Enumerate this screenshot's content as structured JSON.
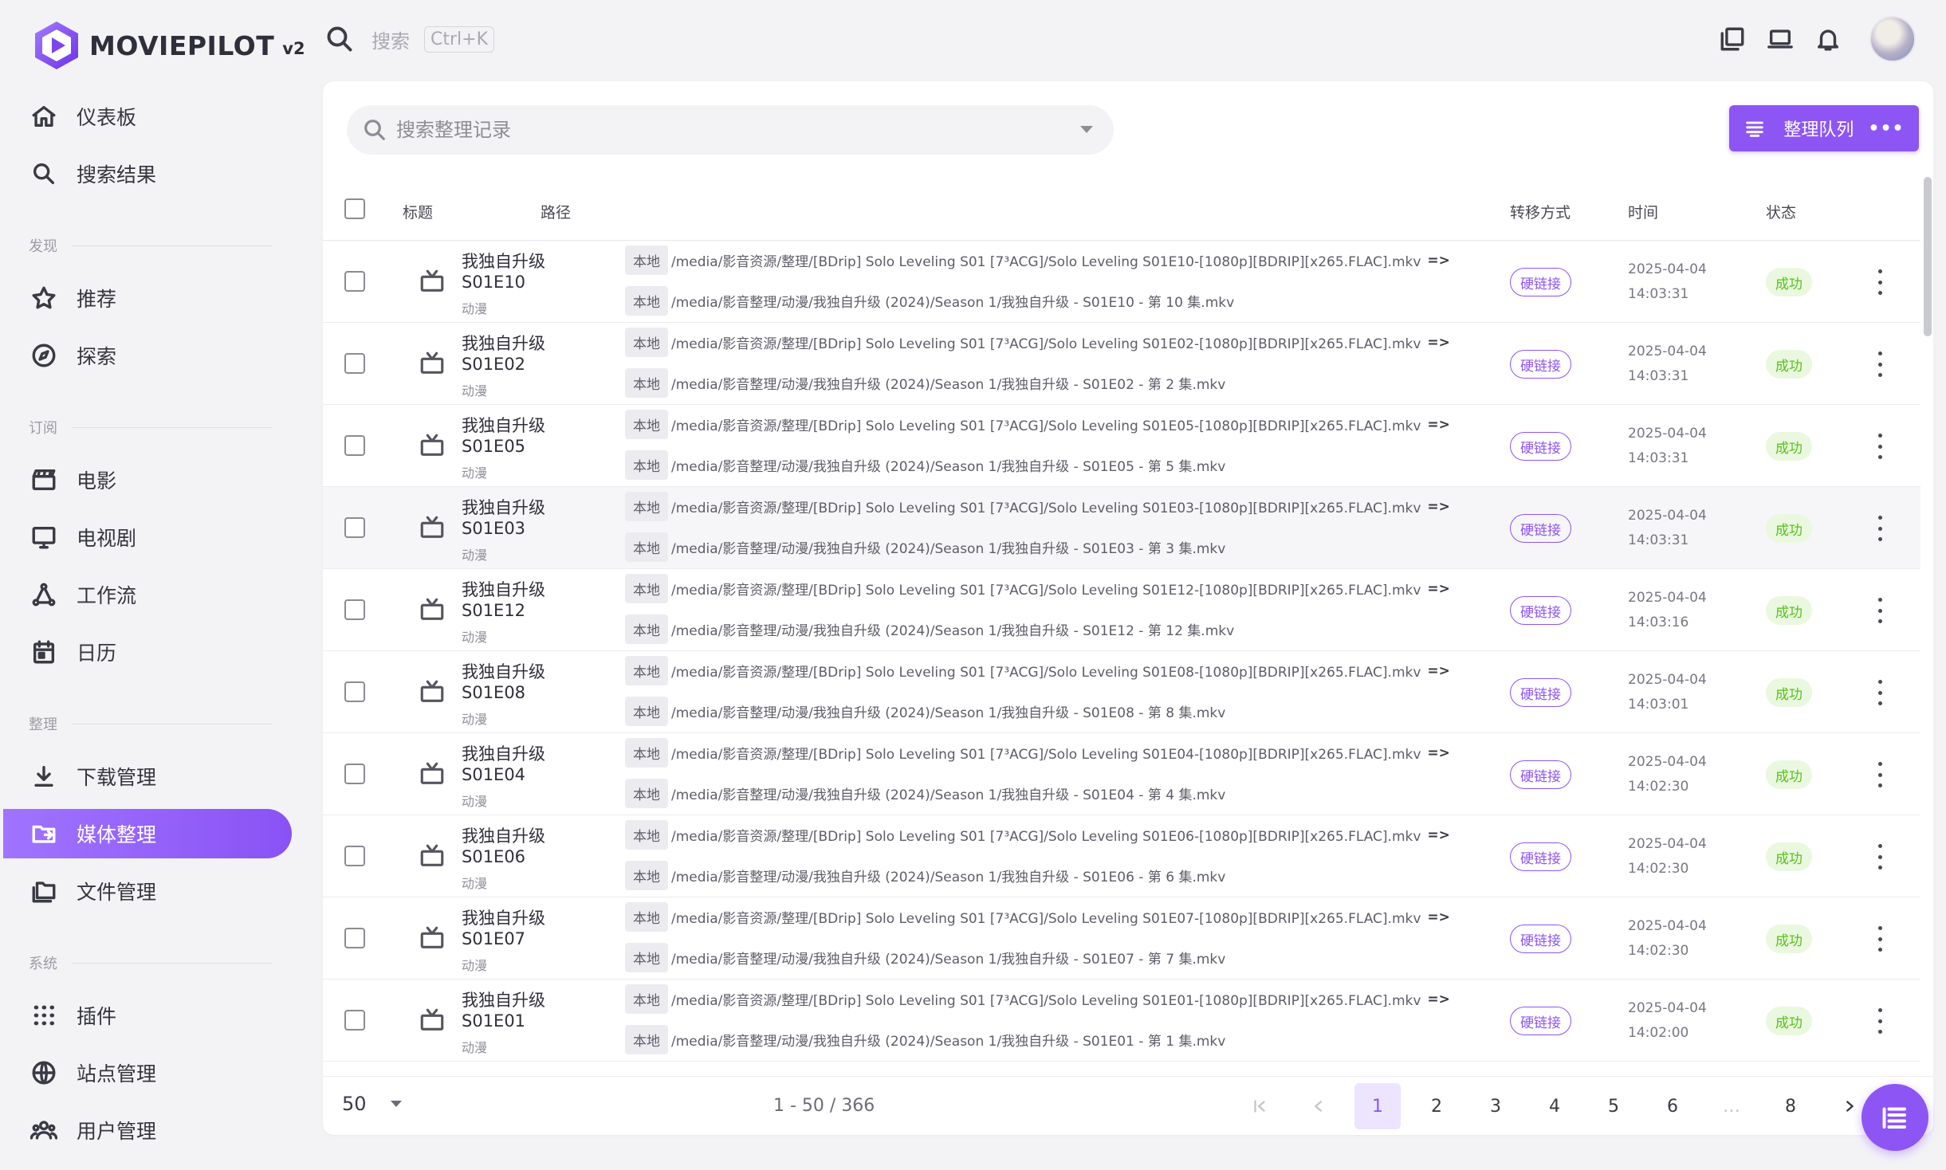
{
  "app": {
    "name": "MOVIEPILOT",
    "version": "v2"
  },
  "topbar": {
    "search_placeholder": "搜索",
    "shortcut": "Ctrl+K"
  },
  "sidebar": {
    "sections": {
      "discover": "发现",
      "subscribe": "订阅",
      "organize": "整理",
      "system": "系统"
    },
    "items": [
      {
        "key": "dashboard",
        "label": "仪表板"
      },
      {
        "key": "search-results",
        "label": "搜索结果"
      },
      {
        "key": "recommend",
        "label": "推荐"
      },
      {
        "key": "explore",
        "label": "探索"
      },
      {
        "key": "movies",
        "label": "电影"
      },
      {
        "key": "tv",
        "label": "电视剧"
      },
      {
        "key": "workflow",
        "label": "工作流"
      },
      {
        "key": "calendar",
        "label": "日历"
      },
      {
        "key": "downloads",
        "label": "下载管理"
      },
      {
        "key": "media-organize",
        "label": "媒体整理",
        "active": true
      },
      {
        "key": "files",
        "label": "文件管理"
      },
      {
        "key": "plugins",
        "label": "插件"
      },
      {
        "key": "sites",
        "label": "站点管理"
      },
      {
        "key": "users",
        "label": "用户管理"
      }
    ]
  },
  "main": {
    "search_placeholder": "搜索整理记录",
    "queue_button": "整理队列",
    "columns": {
      "title": "标题",
      "path": "路径",
      "mode": "转移方式",
      "time": "时间",
      "status": "状态"
    },
    "rows": [
      {
        "title": "我独自升级",
        "episode": "S01E10",
        "category": "动漫",
        "src_tag": "本地",
        "src": "/media/影音资源/整理/[BDrip] Solo Leveling S01 [7³ACG]/Solo Leveling S01E10-[1080p][BDRIP][x265.FLAC].mkv",
        "arrow": "=>",
        "dst_tag": "本地",
        "dst": "/media/影音整理/动漫/我独自升级 (2024)/Season 1/我独自升级 - S01E10 - 第 10 集.mkv",
        "mode": "硬链接",
        "date": "2025-04-04",
        "clock": "14:03:31",
        "status": "成功"
      },
      {
        "title": "我独自升级",
        "episode": "S01E02",
        "category": "动漫",
        "src_tag": "本地",
        "src": "/media/影音资源/整理/[BDrip] Solo Leveling S01 [7³ACG]/Solo Leveling S01E02-[1080p][BDRIP][x265.FLAC].mkv",
        "arrow": "=>",
        "dst_tag": "本地",
        "dst": "/media/影音整理/动漫/我独自升级 (2024)/Season 1/我独自升级 - S01E02 - 第 2 集.mkv",
        "mode": "硬链接",
        "date": "2025-04-04",
        "clock": "14:03:31",
        "status": "成功"
      },
      {
        "title": "我独自升级",
        "episode": "S01E05",
        "category": "动漫",
        "src_tag": "本地",
        "src": "/media/影音资源/整理/[BDrip] Solo Leveling S01 [7³ACG]/Solo Leveling S01E05-[1080p][BDRIP][x265.FLAC].mkv",
        "arrow": "=>",
        "dst_tag": "本地",
        "dst": "/media/影音整理/动漫/我独自升级 (2024)/Season 1/我独自升级 - S01E05 - 第 5 集.mkv",
        "mode": "硬链接",
        "date": "2025-04-04",
        "clock": "14:03:31",
        "status": "成功"
      },
      {
        "title": "我独自升级",
        "episode": "S01E03",
        "category": "动漫",
        "src_tag": "本地",
        "src": "/media/影音资源/整理/[BDrip] Solo Leveling S01 [7³ACG]/Solo Leveling S01E03-[1080p][BDRIP][x265.FLAC].mkv",
        "arrow": "=>",
        "dst_tag": "本地",
        "dst": "/media/影音整理/动漫/我独自升级 (2024)/Season 1/我独自升级 - S01E03 - 第 3 集.mkv",
        "mode": "硬链接",
        "date": "2025-04-04",
        "clock": "14:03:31",
        "status": "成功"
      },
      {
        "title": "我独自升级",
        "episode": "S01E12",
        "category": "动漫",
        "src_tag": "本地",
        "src": "/media/影音资源/整理/[BDrip] Solo Leveling S01 [7³ACG]/Solo Leveling S01E12-[1080p][BDRIP][x265.FLAC].mkv",
        "arrow": "=>",
        "dst_tag": "本地",
        "dst": "/media/影音整理/动漫/我独自升级 (2024)/Season 1/我独自升级 - S01E12 - 第 12 集.mkv",
        "mode": "硬链接",
        "date": "2025-04-04",
        "clock": "14:03:16",
        "status": "成功"
      },
      {
        "title": "我独自升级",
        "episode": "S01E08",
        "category": "动漫",
        "src_tag": "本地",
        "src": "/media/影音资源/整理/[BDrip] Solo Leveling S01 [7³ACG]/Solo Leveling S01E08-[1080p][BDRIP][x265.FLAC].mkv",
        "arrow": "=>",
        "dst_tag": "本地",
        "dst": "/media/影音整理/动漫/我独自升级 (2024)/Season 1/我独自升级 - S01E08 - 第 8 集.mkv",
        "mode": "硬链接",
        "date": "2025-04-04",
        "clock": "14:03:01",
        "status": "成功"
      },
      {
        "title": "我独自升级",
        "episode": "S01E04",
        "category": "动漫",
        "src_tag": "本地",
        "src": "/media/影音资源/整理/[BDrip] Solo Leveling S01 [7³ACG]/Solo Leveling S01E04-[1080p][BDRIP][x265.FLAC].mkv",
        "arrow": "=>",
        "dst_tag": "本地",
        "dst": "/media/影音整理/动漫/我独自升级 (2024)/Season 1/我独自升级 - S01E04 - 第 4 集.mkv",
        "mode": "硬链接",
        "date": "2025-04-04",
        "clock": "14:02:30",
        "status": "成功"
      },
      {
        "title": "我独自升级",
        "episode": "S01E06",
        "category": "动漫",
        "src_tag": "本地",
        "src": "/media/影音资源/整理/[BDrip] Solo Leveling S01 [7³ACG]/Solo Leveling S01E06-[1080p][BDRIP][x265.FLAC].mkv",
        "arrow": "=>",
        "dst_tag": "本地",
        "dst": "/media/影音整理/动漫/我独自升级 (2024)/Season 1/我独自升级 - S01E06 - 第 6 集.mkv",
        "mode": "硬链接",
        "date": "2025-04-04",
        "clock": "14:02:30",
        "status": "成功"
      },
      {
        "title": "我独自升级",
        "episode": "S01E07",
        "category": "动漫",
        "src_tag": "本地",
        "src": "/media/影音资源/整理/[BDrip] Solo Leveling S01 [7³ACG]/Solo Leveling S01E07-[1080p][BDRIP][x265.FLAC].mkv",
        "arrow": "=>",
        "dst_tag": "本地",
        "dst": "/media/影音整理/动漫/我独自升级 (2024)/Season 1/我独自升级 - S01E07 - 第 7 集.mkv",
        "mode": "硬链接",
        "date": "2025-04-04",
        "clock": "14:02:30",
        "status": "成功"
      },
      {
        "title": "我独自升级",
        "episode": "S01E01",
        "category": "动漫",
        "src_tag": "本地",
        "src": "/media/影音资源/整理/[BDrip] Solo Leveling S01 [7³ACG]/Solo Leveling S01E01-[1080p][BDRIP][x265.FLAC].mkv",
        "arrow": "=>",
        "dst_tag": "本地",
        "dst": "/media/影音整理/动漫/我独自升级 (2024)/Season 1/我独自升级 - S01E01 - 第 1 集.mkv",
        "mode": "硬链接",
        "date": "2025-04-04",
        "clock": "14:02:00",
        "status": "成功"
      }
    ],
    "highlighted_row": 3,
    "footer": {
      "per_page": "50",
      "range": "1 - 50 / 366",
      "pages": [
        "1",
        "2",
        "3",
        "4",
        "5",
        "6",
        "…",
        "8"
      ],
      "current_page": "1"
    }
  },
  "colors": {
    "accent": "#8e55f5",
    "success": "#56c21a",
    "success_bg": "#eaf8df",
    "background": "#f3f3f6"
  },
  "icons": {
    "search": "search-icon",
    "shortcut": "keyboard-hint",
    "copy": "copy-icon",
    "laptop": "laptop-icon",
    "bell": "bell-icon",
    "tv": "tv-icon",
    "more": "more-vertical-icon",
    "queue": "list-queue-icon"
  }
}
